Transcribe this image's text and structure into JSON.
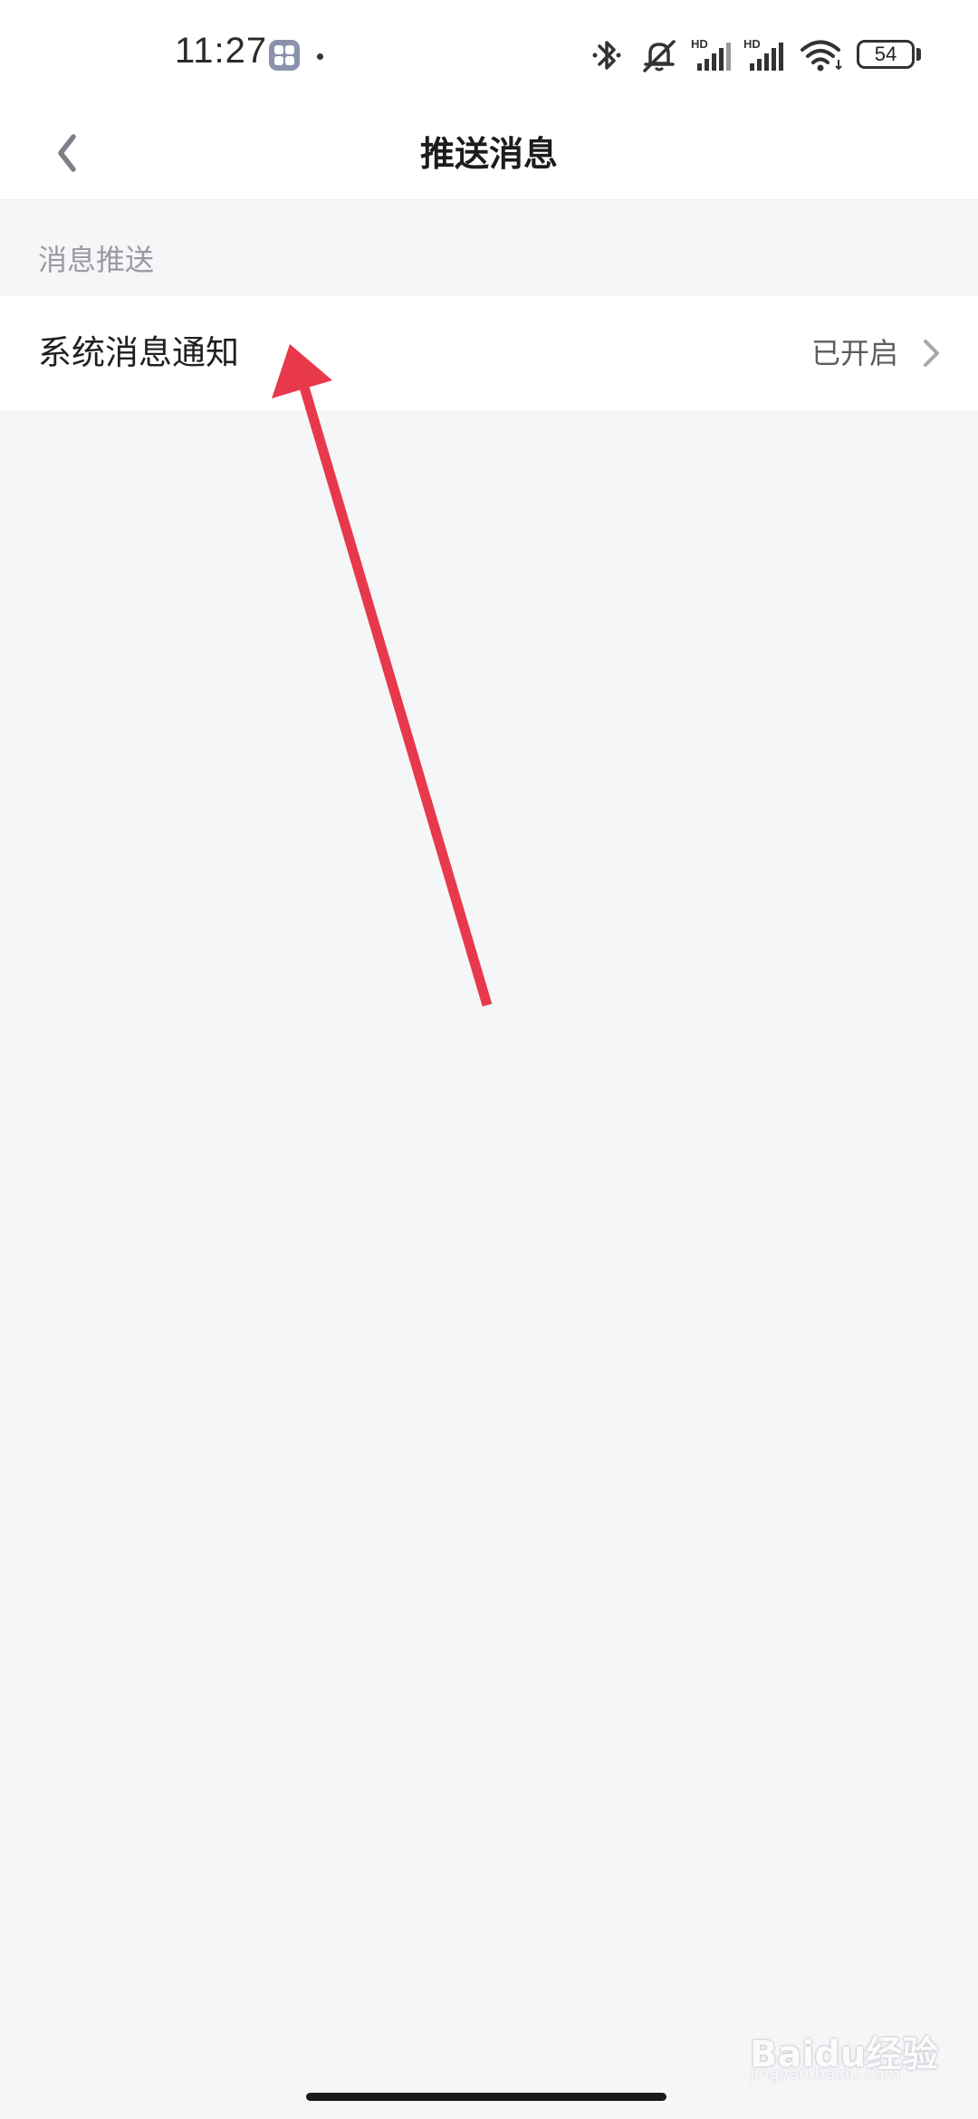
{
  "status_bar": {
    "time": "11:27",
    "battery": "54",
    "network_labels": [
      "HD",
      "HD"
    ],
    "icons": [
      "app-icon",
      "bluetooth-icon",
      "mute-icon",
      "signal-icon",
      "signal-icon",
      "wifi-icon",
      "battery-icon"
    ]
  },
  "nav": {
    "title": "推送消息",
    "back_icon": "chevron-left-icon"
  },
  "section": {
    "header": "消息推送",
    "rows": [
      {
        "label": "系统消息通知",
        "value": "已开启",
        "icon": "chevron-right-icon"
      }
    ]
  },
  "watermark": {
    "text": "Baidu经验",
    "url": "jingyan.baidu.com"
  },
  "colors": {
    "background": "#f5f6f8",
    "surface": "#ffffff",
    "annotation_arrow": "#e8384c",
    "section_header": "#9a9ba0"
  }
}
